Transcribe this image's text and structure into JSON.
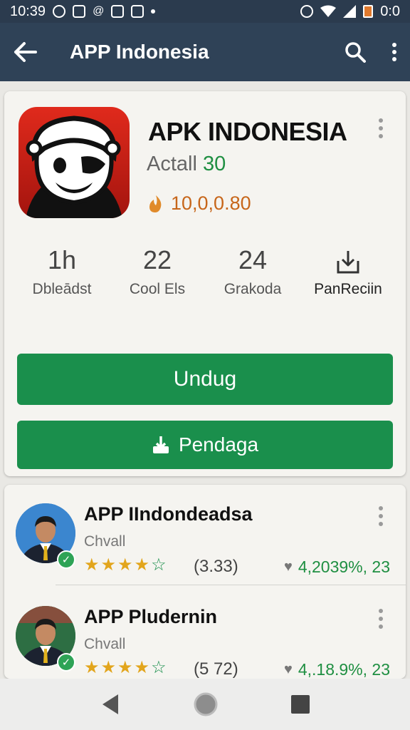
{
  "status": {
    "time": "10:39",
    "right_text": "0:0"
  },
  "appbar": {
    "title": "APP Indonesia",
    "back_icon": "back-arrow-icon",
    "search_icon": "search-icon",
    "menu_icon": "more-vert-icon"
  },
  "app": {
    "name": "APK INDONESIA",
    "subtitle_label": "Actall",
    "subtitle_number": "30",
    "rank": "10,0,0.80",
    "rank_icon": "flame-icon"
  },
  "stats": [
    {
      "value": "1h",
      "label": "Dbleādst"
    },
    {
      "value": "22",
      "label": "Cool Els"
    },
    {
      "value": "24",
      "label": "Grakoda"
    },
    {
      "value": "",
      "label": "PanReciin",
      "icon": "download-box-icon"
    }
  ],
  "buttons": {
    "primary": "Undug",
    "secondary": "Pendaga"
  },
  "list": [
    {
      "name": "APP IIndondeadsa",
      "developer": "Chvall",
      "stars": "★★★★",
      "rating_count": "(3.33)",
      "downloads": "4,2039%, 23"
    },
    {
      "name": "APP Pludernin",
      "developer": "Chvall",
      "stars": "★★★★",
      "rating_count": "(5 72)",
      "downloads": "4,.18.9%, 23"
    }
  ],
  "colors": {
    "appbar": "#2f4257",
    "accent_green": "#1a8f4c",
    "rank_orange": "#c7661a"
  }
}
